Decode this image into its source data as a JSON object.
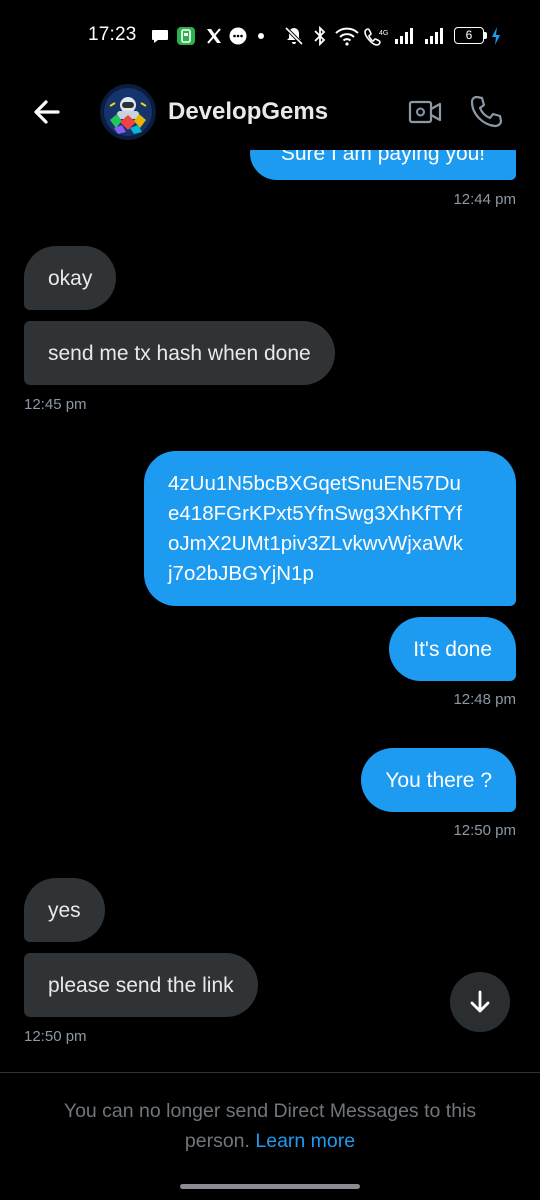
{
  "status_bar": {
    "time": "17:23",
    "battery_level": "6",
    "left_icons": [
      "chat-bubble-icon",
      "green-app-icon",
      "x-logo-icon",
      "message-icon",
      "dot-icon"
    ],
    "right_icons": [
      "mute-icon",
      "bluetooth-icon",
      "wifi-icon",
      "volte-icon",
      "signal-icon",
      "signal-icon",
      "battery-icon",
      "charging-bolt-icon"
    ]
  },
  "header": {
    "contact_name": "DevelopGems",
    "back_icon": "back-arrow-icon",
    "video_icon": "video-camera-icon",
    "call_icon": "phone-icon"
  },
  "messages": [
    {
      "direction": "outgoing",
      "text": "Sure I am paying you!",
      "partial": true
    },
    {
      "direction": "timestamp",
      "align": "right",
      "text": "12:44 pm"
    },
    {
      "direction": "incoming",
      "text": "okay"
    },
    {
      "direction": "incoming",
      "text": "send me tx hash when done"
    },
    {
      "direction": "timestamp",
      "align": "left",
      "text": "12:45 pm"
    },
    {
      "direction": "outgoing",
      "lines": [
        "4zUu1N5bcBXGqetSnuEN57Du",
        "e418FGrKPxt5YfnSwg3XhKfTYf",
        "oJmX2UMt1piv3ZLvkwvWjxaWk",
        "j7o2bJBGYjN1p"
      ]
    },
    {
      "direction": "outgoing",
      "text": "It's done"
    },
    {
      "direction": "timestamp",
      "align": "right",
      "text": "12:48 pm"
    },
    {
      "direction": "outgoing",
      "text": "You there ?"
    },
    {
      "direction": "timestamp",
      "align": "right",
      "text": "12:50 pm"
    },
    {
      "direction": "incoming",
      "text": "yes"
    },
    {
      "direction": "incoming",
      "text": "please send the link"
    },
    {
      "direction": "timestamp",
      "align": "left",
      "text": "12:50 pm"
    }
  ],
  "scroll_button": {
    "icon": "arrow-down-icon"
  },
  "footer": {
    "notice": "You can no longer send Direct Messages to this person.",
    "link": "Learn more"
  },
  "colors": {
    "background": "#000000",
    "outgoing_bubble": "#1d9bf0",
    "incoming_bubble": "#2f3336",
    "timestamp": "#8b98a5",
    "link": "#1d9bf0",
    "text": "#e7e9ea"
  }
}
